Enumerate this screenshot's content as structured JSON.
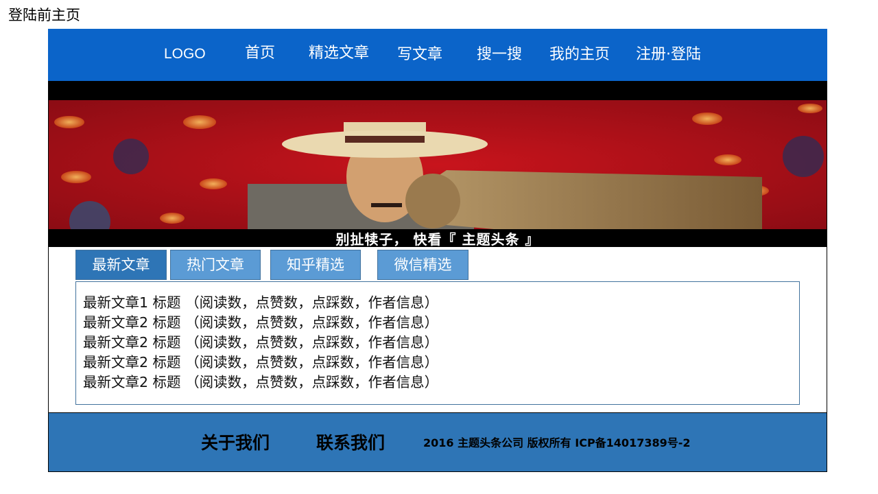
{
  "page_caption": "登陆前主页",
  "nav": {
    "logo": "LOGO",
    "items": [
      "首页",
      "精选文章",
      "写文章",
      "搜一搜",
      "我的主页",
      "注册·登陆"
    ]
  },
  "banner": {
    "caption": "别扯犊子， 快看『 主题头条 』"
  },
  "tabs": [
    "最新文章",
    "热门文章",
    "知乎精选",
    "微信精选"
  ],
  "active_tab": "最新文章",
  "articles": [
    "最新文章1 标题 （阅读数，点赞数，点踩数，作者信息）",
    "最新文章2 标题 （阅读数，点赞数，点踩数，作者信息）",
    "最新文章2 标题 （阅读数，点赞数，点踩数，作者信息）",
    "最新文章2 标题 （阅读数，点赞数，点踩数，作者信息）",
    "最新文章2 标题 （阅读数，点赞数，点踩数，作者信息）"
  ],
  "footer": {
    "about": "关于我们",
    "contact": "联系我们",
    "copyright": "2016 主题头条公司 版权所有  ICP备14017389号-2"
  },
  "colors": {
    "navbar": "#0b64c9",
    "tab": "#5b9bd5",
    "tab_active": "#2e75b6",
    "footer": "#2e75b6"
  }
}
